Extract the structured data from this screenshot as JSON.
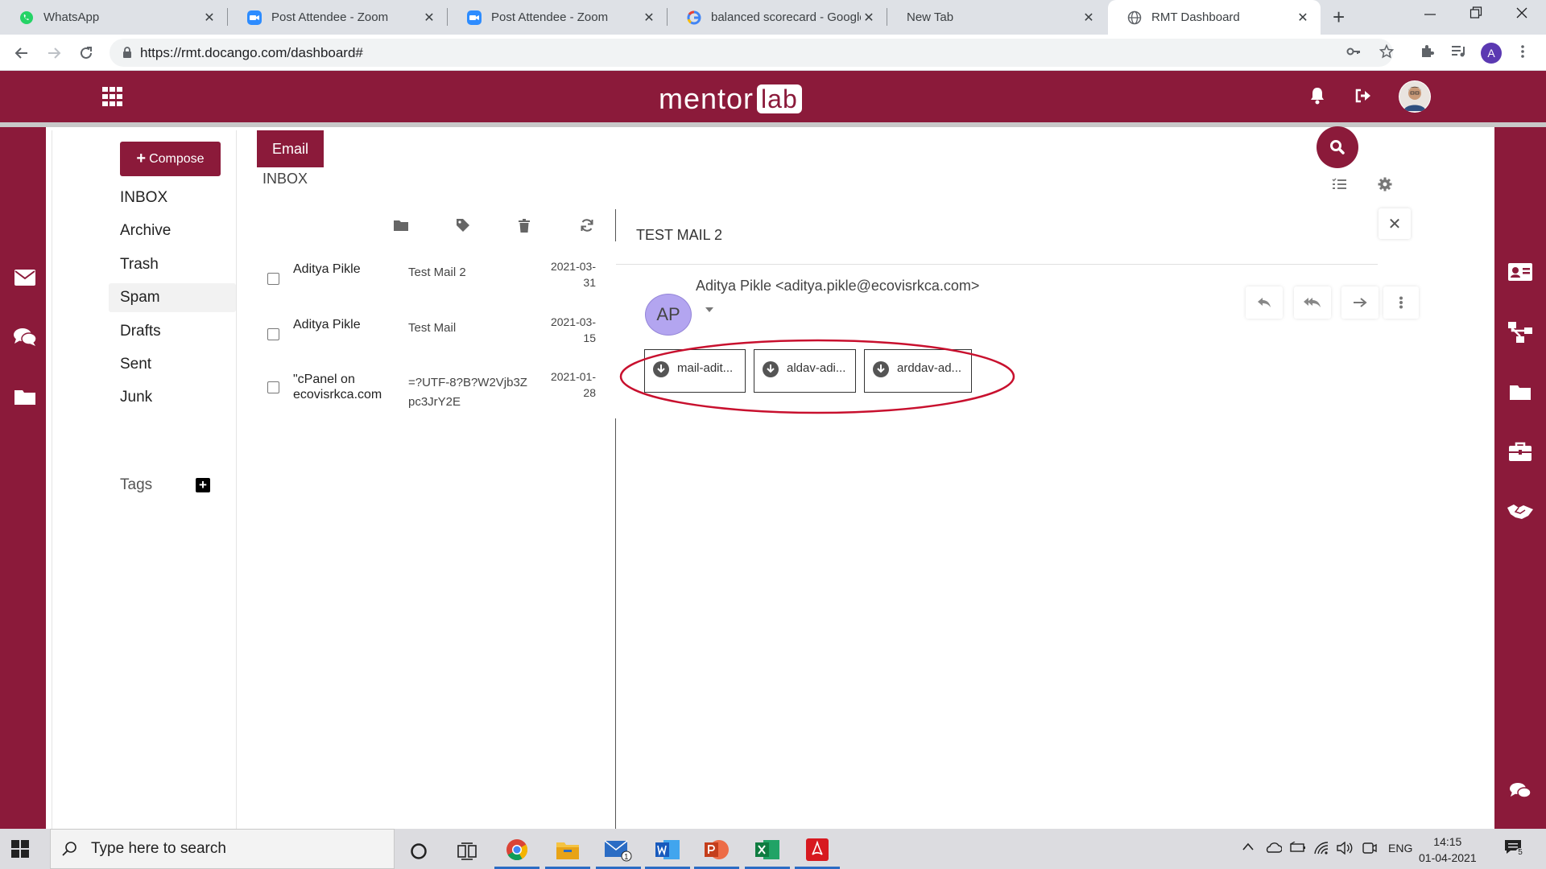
{
  "browser": {
    "tabs": [
      {
        "title": "WhatsApp",
        "icon": "whatsapp-icon",
        "active": false
      },
      {
        "title": "Post Attendee - Zoom",
        "icon": "zoom-icon",
        "active": false
      },
      {
        "title": "Post Attendee - Zoom",
        "icon": "zoom-icon",
        "active": false
      },
      {
        "title": "balanced scorecard - Google",
        "icon": "google-icon",
        "active": false
      },
      {
        "title": "New Tab",
        "icon": "",
        "active": false
      },
      {
        "title": "RMT Dashboard",
        "icon": "globe-icon",
        "active": true
      }
    ],
    "tab_close": "✕",
    "new_tab": "+",
    "url": "https://rmt.docango.com/dashboard#",
    "profile_initial": "A"
  },
  "header": {
    "logo_text": "mentor",
    "logo_badge": "lab"
  },
  "sidebar": {
    "compose_label": "Compose",
    "folders": [
      {
        "label": "INBOX",
        "selected": false
      },
      {
        "label": "Archive",
        "selected": false
      },
      {
        "label": "Trash",
        "selected": false
      },
      {
        "label": "Spam",
        "selected": true
      },
      {
        "label": "Drafts",
        "selected": false
      },
      {
        "label": "Sent",
        "selected": false
      },
      {
        "label": "Junk",
        "selected": false
      }
    ],
    "tags_label": "Tags",
    "tags_add": "+"
  },
  "list": {
    "tab_label": "Email",
    "folder_label": "INBOX",
    "emails": [
      {
        "sender": "Aditya Pikle",
        "subject": "Test Mail 2",
        "date_line1": "2021-03-",
        "date_line2": "31"
      },
      {
        "sender": "Aditya Pikle",
        "subject": "Test Mail",
        "date_line1": "2021-03-",
        "date_line2": "15"
      },
      {
        "sender": "\"cPanel on ecovisrkca.com",
        "subject": "=?UTF-8?B?W2Vjb3Zpc3JrY2E",
        "date_line1": "2021-01-",
        "date_line2": "28"
      }
    ]
  },
  "reader": {
    "subject": "TEST MAIL 2",
    "avatar_initials": "AP",
    "from": "Aditya Pikle <aditya.pikle@ecovisrkca.com>",
    "close": "✕",
    "attachments": [
      "mail-adit...",
      "aldav-adi...",
      "arddav-ad..."
    ]
  },
  "taskbar": {
    "search_placeholder": "Type here to search",
    "language": "ENG",
    "time": "14:15",
    "date": "01-04-2021",
    "notification_count": "5",
    "mail_badge": "1"
  },
  "colors": {
    "brand": "#8b1a3a",
    "annotation": "#c8102e"
  }
}
